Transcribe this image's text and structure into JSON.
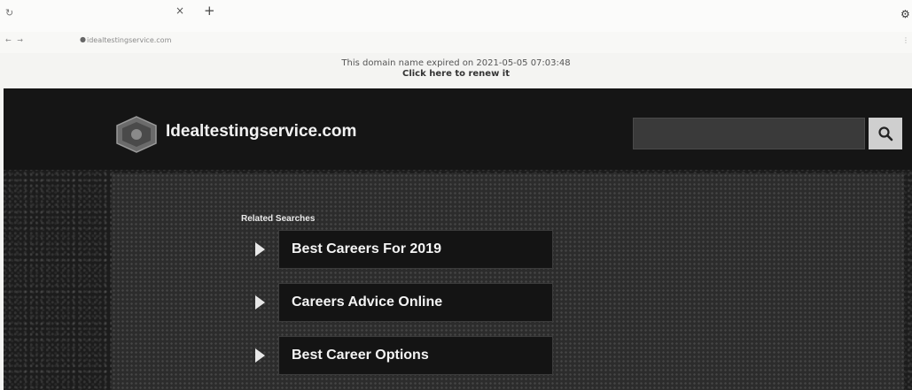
{
  "browser": {
    "tab_close_glyph": "×",
    "tab_new_glyph": "+",
    "url": "idealtestingservice.com",
    "icons": [
      "reload-icon",
      "close-icon",
      "new-tab-icon",
      "menu-icon"
    ]
  },
  "notice": {
    "expired_text": "This domain name expired on 2021-05-05 07:03:48",
    "renew_prefix": "Click here",
    "renew_suffix": " to renew it"
  },
  "site": {
    "name": "Idealtestingservice.com",
    "search_placeholder": ""
  },
  "related": {
    "heading": "Related Searches",
    "items": [
      {
        "label": "Best Careers For 2019"
      },
      {
        "label": "Careers Advice Online"
      },
      {
        "label": "Best Career Options"
      }
    ]
  },
  "colors": {
    "page_bg": "#1c1c1c",
    "result_bg": "#141414",
    "text": "#f4f4f4"
  }
}
